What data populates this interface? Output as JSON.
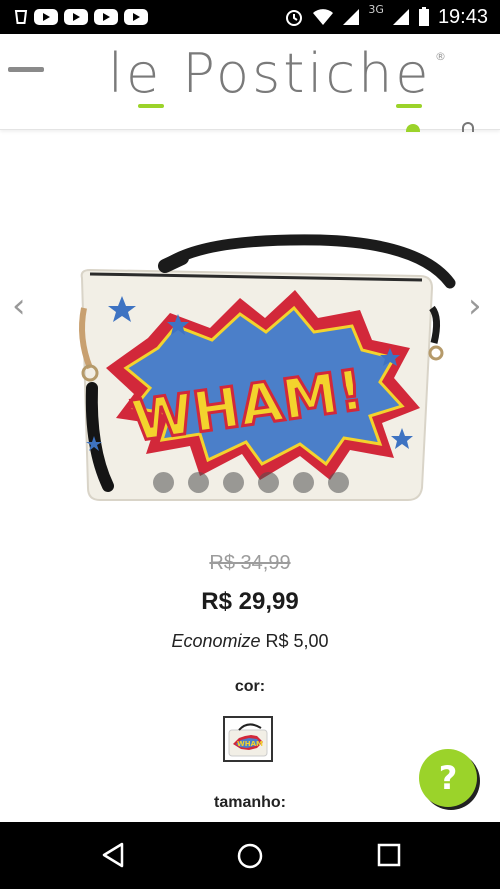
{
  "status_bar": {
    "time": "19:43",
    "network": "3G",
    "icons": [
      "notification-cup-icon",
      "youtube-icon",
      "youtube-icon",
      "youtube-icon",
      "youtube-icon",
      "alarm-icon",
      "wifi-icon",
      "signal-icon",
      "battery-icon"
    ]
  },
  "header": {
    "logo_text": "le Postiche",
    "logo_reg": "®",
    "accent_color": "#9bd32a"
  },
  "carousel": {
    "slide_count": 6,
    "left_arrow": "‹",
    "right_arrow": "›"
  },
  "product": {
    "old_price": "R$ 34,99",
    "price": "R$ 29,99",
    "savings_label": "Economize",
    "savings_value": "R$ 5,00",
    "color_label": "cor:",
    "size_label": "tamanho:"
  },
  "help": {
    "label": "?"
  }
}
